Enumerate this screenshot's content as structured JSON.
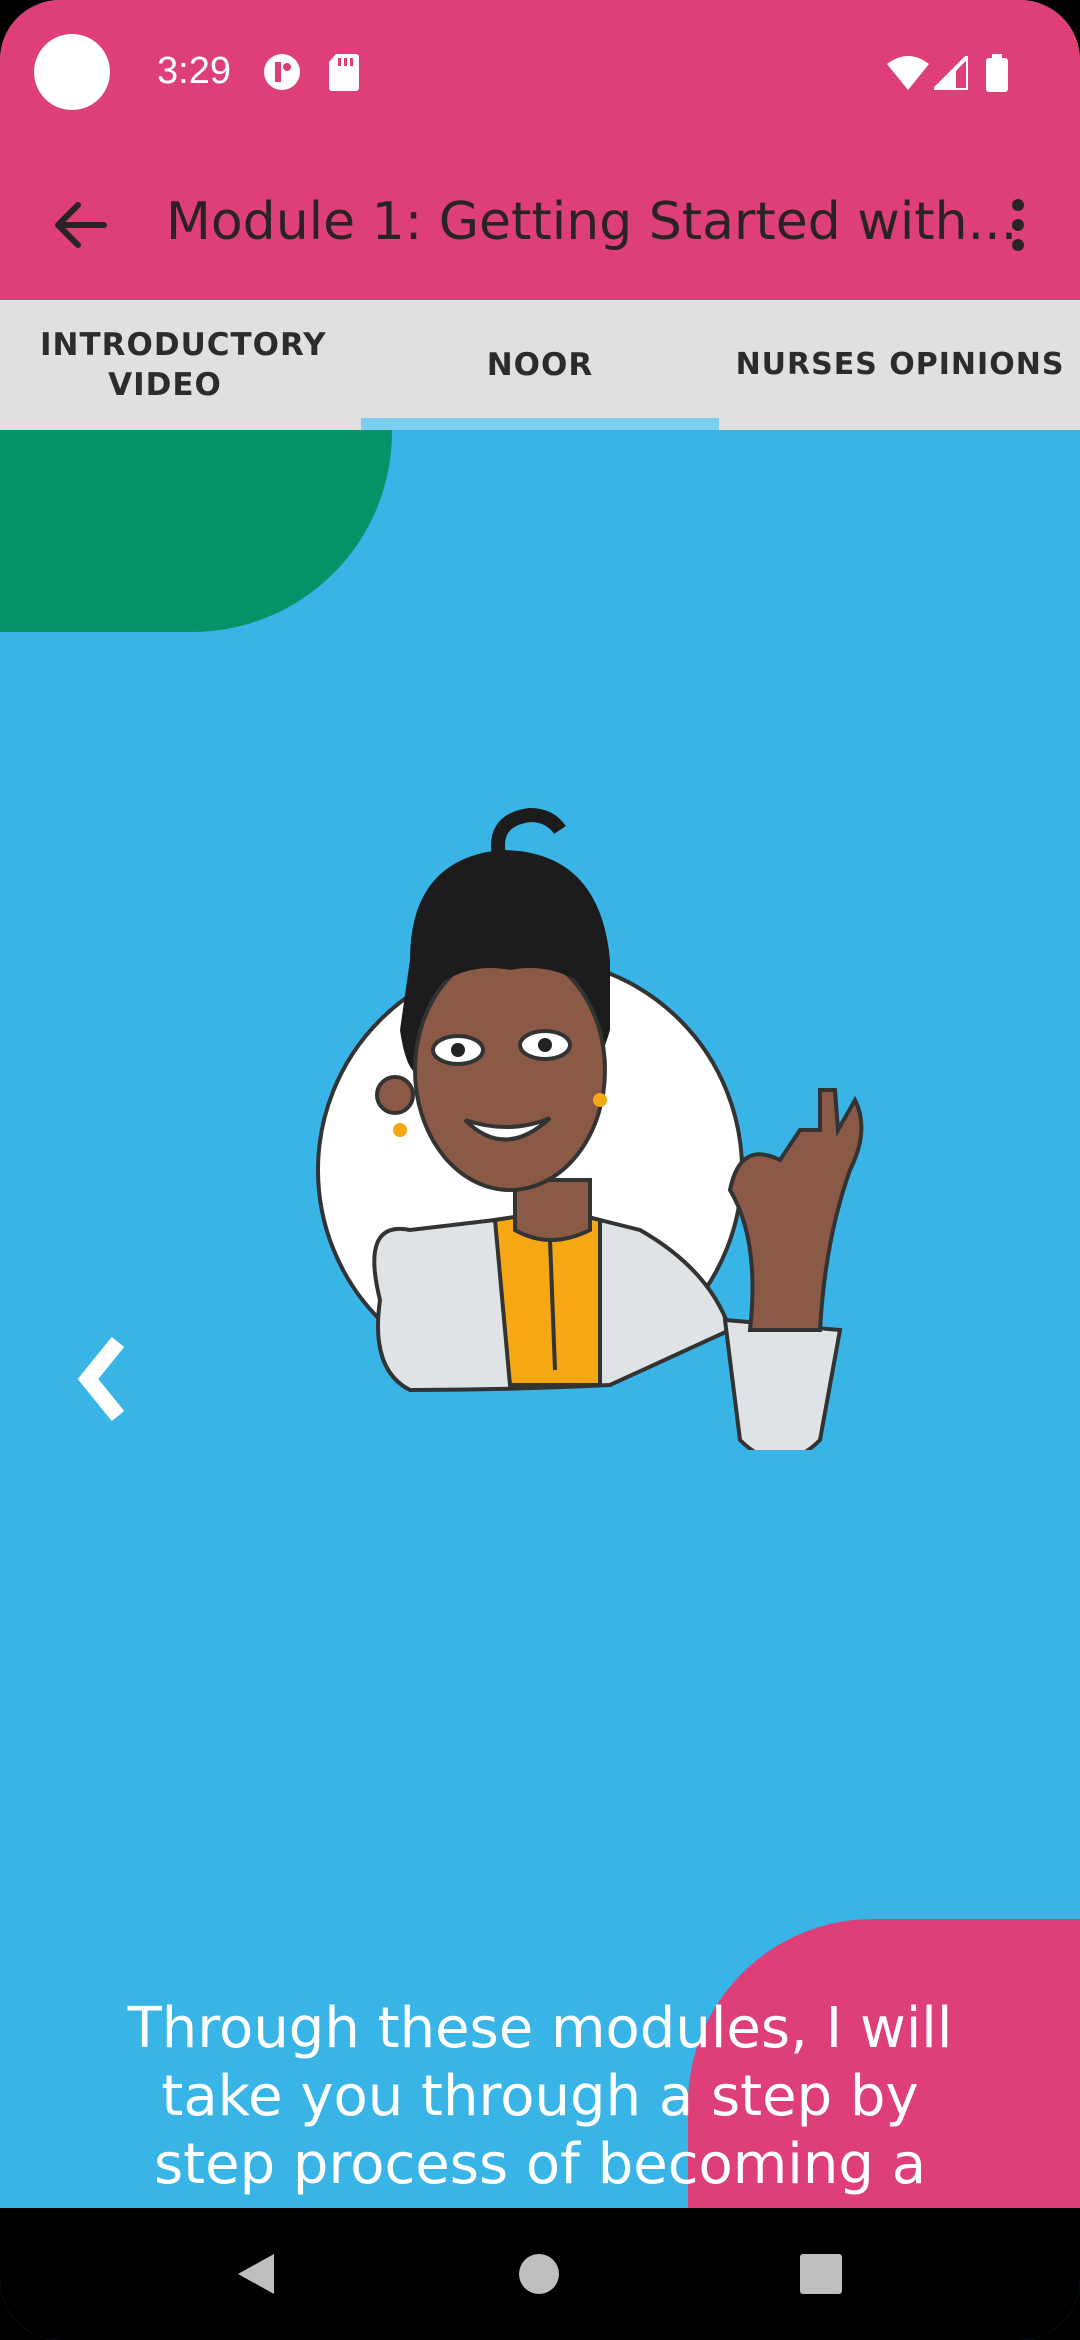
{
  "status_bar": {
    "time": "3:29",
    "icons": [
      "notification-app-icon",
      "sd-card-icon",
      "wifi-icon",
      "signal-icon",
      "battery-icon"
    ]
  },
  "app_bar": {
    "title": "Module 1: Getting Started with...",
    "back_icon": "arrow-back-icon",
    "menu_icon": "more-vert-icon"
  },
  "tabs": [
    {
      "label": "INTRODUCTORY VIDEO",
      "selected": false
    },
    {
      "label": "NOOR",
      "selected": true
    },
    {
      "label": "NURSES OPINIONS",
      "selected": false
    }
  ],
  "content": {
    "caption": "Through these modules, I will take you through a step by step process of becoming a CCP Trainer.",
    "prev_icon": "chevron-left-icon",
    "illustration": "waving-nurse-noor-illustration"
  },
  "colors": {
    "primary": "#df3f78",
    "tab_bar": "#e0dfe2",
    "tab_indicator": "#7bd0f1",
    "background": "#38b4e6",
    "accent_green": "#05946a"
  },
  "nav_bar": {
    "buttons": [
      "back-triangle-icon",
      "home-circle-icon",
      "recents-square-icon"
    ]
  }
}
